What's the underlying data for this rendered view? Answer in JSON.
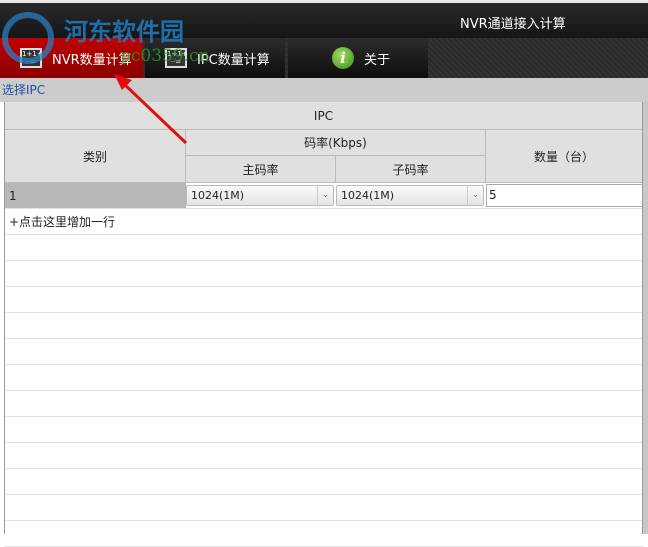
{
  "window": {
    "title": "NVR通道接入计算"
  },
  "tabs": [
    {
      "label": "NVR数量计算",
      "active": true
    },
    {
      "label": "IPC数量计算"
    },
    {
      "label": "关于"
    }
  ],
  "section": {
    "label": "选择IPC"
  },
  "table": {
    "group_header": "IPC",
    "col_category": "类别",
    "col_bitrate": "码率(Kbps)",
    "col_main": "主码率",
    "col_sub": "子码率",
    "col_qty": "数量（台）",
    "rows": [
      {
        "category": "1",
        "main": "1024(1M)",
        "sub": "1024(1M)",
        "qty": "5"
      }
    ],
    "add_row": "+点击这里增加一行"
  },
  "watermark": {
    "name": "河东软件园",
    "url": "www.pc0359.cn"
  },
  "colors": {
    "active_tab": "#b00000",
    "link": "#2050a0",
    "arrow": "#e01010"
  }
}
